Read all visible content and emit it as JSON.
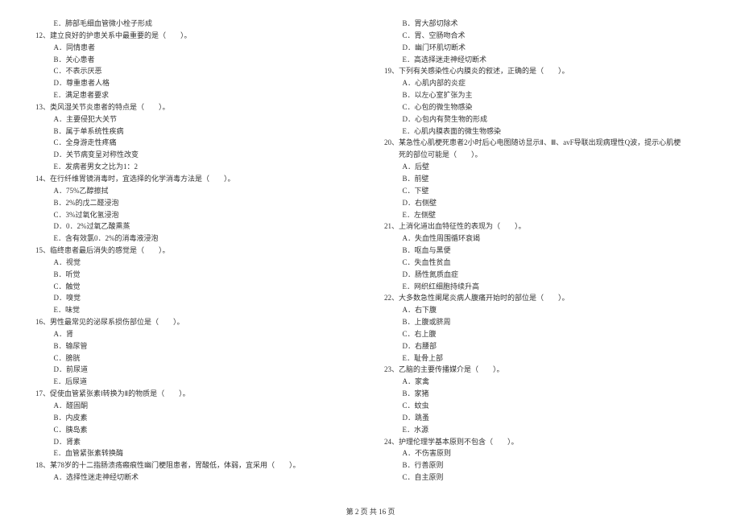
{
  "footer": "第 2 页  共 16 页",
  "leftCol": [
    {
      "type": "opt-cont",
      "label": "E",
      "text": "肺部毛细血管微小栓子形成"
    },
    {
      "type": "q",
      "num": "12、",
      "text": "建立良好的护患关系中最重要的是（　　）。"
    },
    {
      "type": "opt",
      "label": "A",
      "text": "同情患者"
    },
    {
      "type": "opt",
      "label": "B",
      "text": "关心患者"
    },
    {
      "type": "opt",
      "label": "C",
      "text": "不表示厌恶"
    },
    {
      "type": "opt",
      "label": "D",
      "text": "尊重患者人格"
    },
    {
      "type": "opt",
      "label": "E",
      "text": "满足患者要求"
    },
    {
      "type": "q",
      "num": "13、",
      "text": "类风湿关节炎患者的特点是（　　）。"
    },
    {
      "type": "opt",
      "label": "A",
      "text": "主要侵犯大关节"
    },
    {
      "type": "opt",
      "label": "B",
      "text": "属于单系统性疾病"
    },
    {
      "type": "opt",
      "label": "C",
      "text": "全身游走性疼痛"
    },
    {
      "type": "opt",
      "label": "D",
      "text": "关节病变呈对称性改变"
    },
    {
      "type": "opt",
      "label": "E",
      "text": "发病者男女之比为1：2"
    },
    {
      "type": "q",
      "num": "14、",
      "text": "在行纤维胃镜消毒时，宜选择的化学消毒方法是（　　）。"
    },
    {
      "type": "opt",
      "label": "A",
      "text": "75%乙醇擦拭"
    },
    {
      "type": "opt",
      "label": "B",
      "text": "2%的戊二醛浸泡"
    },
    {
      "type": "opt",
      "label": "C",
      "text": "3%过氧化氢浸泡"
    },
    {
      "type": "opt",
      "label": "D",
      "text": "0．2%过氧乙酸熏蒸"
    },
    {
      "type": "opt",
      "label": "E",
      "text": "含有效氯0．2%的消毒液浸泡"
    },
    {
      "type": "q",
      "num": "15、",
      "text": "临终患者最后消失的感觉是（　　）。"
    },
    {
      "type": "opt",
      "label": "A",
      "text": "视觉"
    },
    {
      "type": "opt",
      "label": "B",
      "text": "听觉"
    },
    {
      "type": "opt",
      "label": "C",
      "text": "触觉"
    },
    {
      "type": "opt",
      "label": "D",
      "text": "嗅觉"
    },
    {
      "type": "opt",
      "label": "E",
      "text": "味觉"
    },
    {
      "type": "q",
      "num": "16、",
      "text": "男性最常见的泌尿系损伤部位是（　　）。"
    },
    {
      "type": "opt",
      "label": "A",
      "text": "肾"
    },
    {
      "type": "opt",
      "label": "B",
      "text": "输尿管"
    },
    {
      "type": "opt",
      "label": "C",
      "text": "膀胱"
    },
    {
      "type": "opt",
      "label": "D",
      "text": "前尿道"
    },
    {
      "type": "opt",
      "label": "E",
      "text": "后尿道"
    },
    {
      "type": "q",
      "num": "17、",
      "text": "促使血管紧张素Ⅰ转换为Ⅱ的物质是（　　）。"
    },
    {
      "type": "opt",
      "label": "A",
      "text": "醛固酮"
    },
    {
      "type": "opt",
      "label": "B",
      "text": "内皮素"
    },
    {
      "type": "opt",
      "label": "C",
      "text": "胰岛素"
    },
    {
      "type": "opt",
      "label": "D",
      "text": "肾素"
    },
    {
      "type": "opt",
      "label": "E",
      "text": "血管紧张素转换酶"
    },
    {
      "type": "q",
      "num": "18、",
      "text": "某78岁的十二指肠溃疡瘢痕性幽门梗阻患者，胃酸低，体弱，宜采用（　　）。"
    },
    {
      "type": "opt",
      "label": "A",
      "text": "选择性迷走神经切断术"
    }
  ],
  "rightCol": [
    {
      "type": "opt-cont",
      "label": "B",
      "text": "胃大部切除术"
    },
    {
      "type": "opt-cont",
      "label": "C",
      "text": "胃、空肠吻合术"
    },
    {
      "type": "opt-cont",
      "label": "D",
      "text": "幽门环肌切断术"
    },
    {
      "type": "opt-cont",
      "label": "E",
      "text": "高选择迷走神经切断术"
    },
    {
      "type": "q",
      "num": "19、",
      "text": "下列有关感染性心内膜炎的叙述，正确的是（　　）。"
    },
    {
      "type": "opt",
      "label": "A",
      "text": "心肌内部的炎症"
    },
    {
      "type": "opt",
      "label": "B",
      "text": "以左心室扩张为主"
    },
    {
      "type": "opt",
      "label": "C",
      "text": "心包的微生物感染"
    },
    {
      "type": "opt",
      "label": "D",
      "text": "心包内有赘生物的形成"
    },
    {
      "type": "opt",
      "label": "E",
      "text": "心肌内膜表面的微生物感染"
    },
    {
      "type": "q",
      "num": "20、",
      "text": "某急性心肌梗死患者2小时后心电图随访显示Ⅱ、Ⅲ、avF导联出现病理性Q波，提示心肌梗"
    },
    {
      "type": "q-cont",
      "text": "死的部位可能是（　　）。"
    },
    {
      "type": "opt",
      "label": "A",
      "text": "后壁"
    },
    {
      "type": "opt",
      "label": "B",
      "text": "前壁"
    },
    {
      "type": "opt",
      "label": "C",
      "text": "下壁"
    },
    {
      "type": "opt",
      "label": "D",
      "text": "右侧壁"
    },
    {
      "type": "opt",
      "label": "E",
      "text": "左侧壁"
    },
    {
      "type": "q",
      "num": "21、",
      "text": "上消化道出血特征性的表现为（　　）。"
    },
    {
      "type": "opt",
      "label": "A",
      "text": "失血性周围循环衰竭"
    },
    {
      "type": "opt",
      "label": "B",
      "text": "呕血与黑便"
    },
    {
      "type": "opt",
      "label": "C",
      "text": "失血性贫血"
    },
    {
      "type": "opt",
      "label": "D",
      "text": "肠性氮质血症"
    },
    {
      "type": "opt",
      "label": "E",
      "text": "网织红细胞持续升高"
    },
    {
      "type": "q",
      "num": "22、",
      "text": "大多数急性阑尾炎病人腹痛开始时的部位是（　　）。"
    },
    {
      "type": "opt",
      "label": "A",
      "text": "右下腹"
    },
    {
      "type": "opt",
      "label": "B",
      "text": "上腹或脐周"
    },
    {
      "type": "opt",
      "label": "C",
      "text": "右上腹"
    },
    {
      "type": "opt",
      "label": "D",
      "text": "右腰部"
    },
    {
      "type": "opt",
      "label": "E",
      "text": "耻骨上部"
    },
    {
      "type": "q",
      "num": "23、",
      "text": "乙脑的主要传播媒介是（　　）。"
    },
    {
      "type": "opt",
      "label": "A",
      "text": "家禽"
    },
    {
      "type": "opt",
      "label": "B",
      "text": "家猪"
    },
    {
      "type": "opt",
      "label": "C",
      "text": "蚊虫"
    },
    {
      "type": "opt",
      "label": "D",
      "text": "跳蚤"
    },
    {
      "type": "opt",
      "label": "E",
      "text": "水源"
    },
    {
      "type": "q",
      "num": "24、",
      "text": "护理伦理学基本原则不包含（　　）。"
    },
    {
      "type": "opt",
      "label": "A",
      "text": "不伤害原则"
    },
    {
      "type": "opt",
      "label": "B",
      "text": "行善原则"
    },
    {
      "type": "opt",
      "label": "C",
      "text": "自主原则"
    }
  ]
}
